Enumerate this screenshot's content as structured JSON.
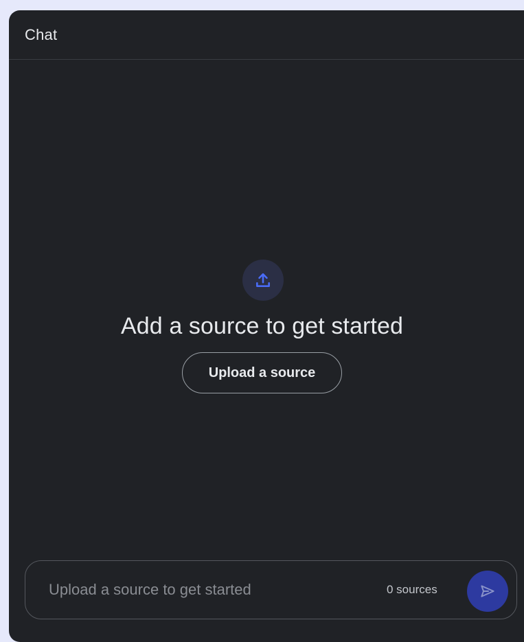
{
  "panel": {
    "title": "Chat"
  },
  "empty_state": {
    "icon": "upload-icon",
    "headline": "Add a source to get started",
    "upload_button_label": "Upload a source"
  },
  "composer": {
    "placeholder": "Upload a source to get started",
    "value": "",
    "source_count_label": "0 sources",
    "send_icon": "send-icon"
  },
  "colors": {
    "page_background": "#e6e9fb",
    "panel_background": "#202226",
    "accent": "#4a6cf7",
    "send_button": "#2d3aa0"
  }
}
